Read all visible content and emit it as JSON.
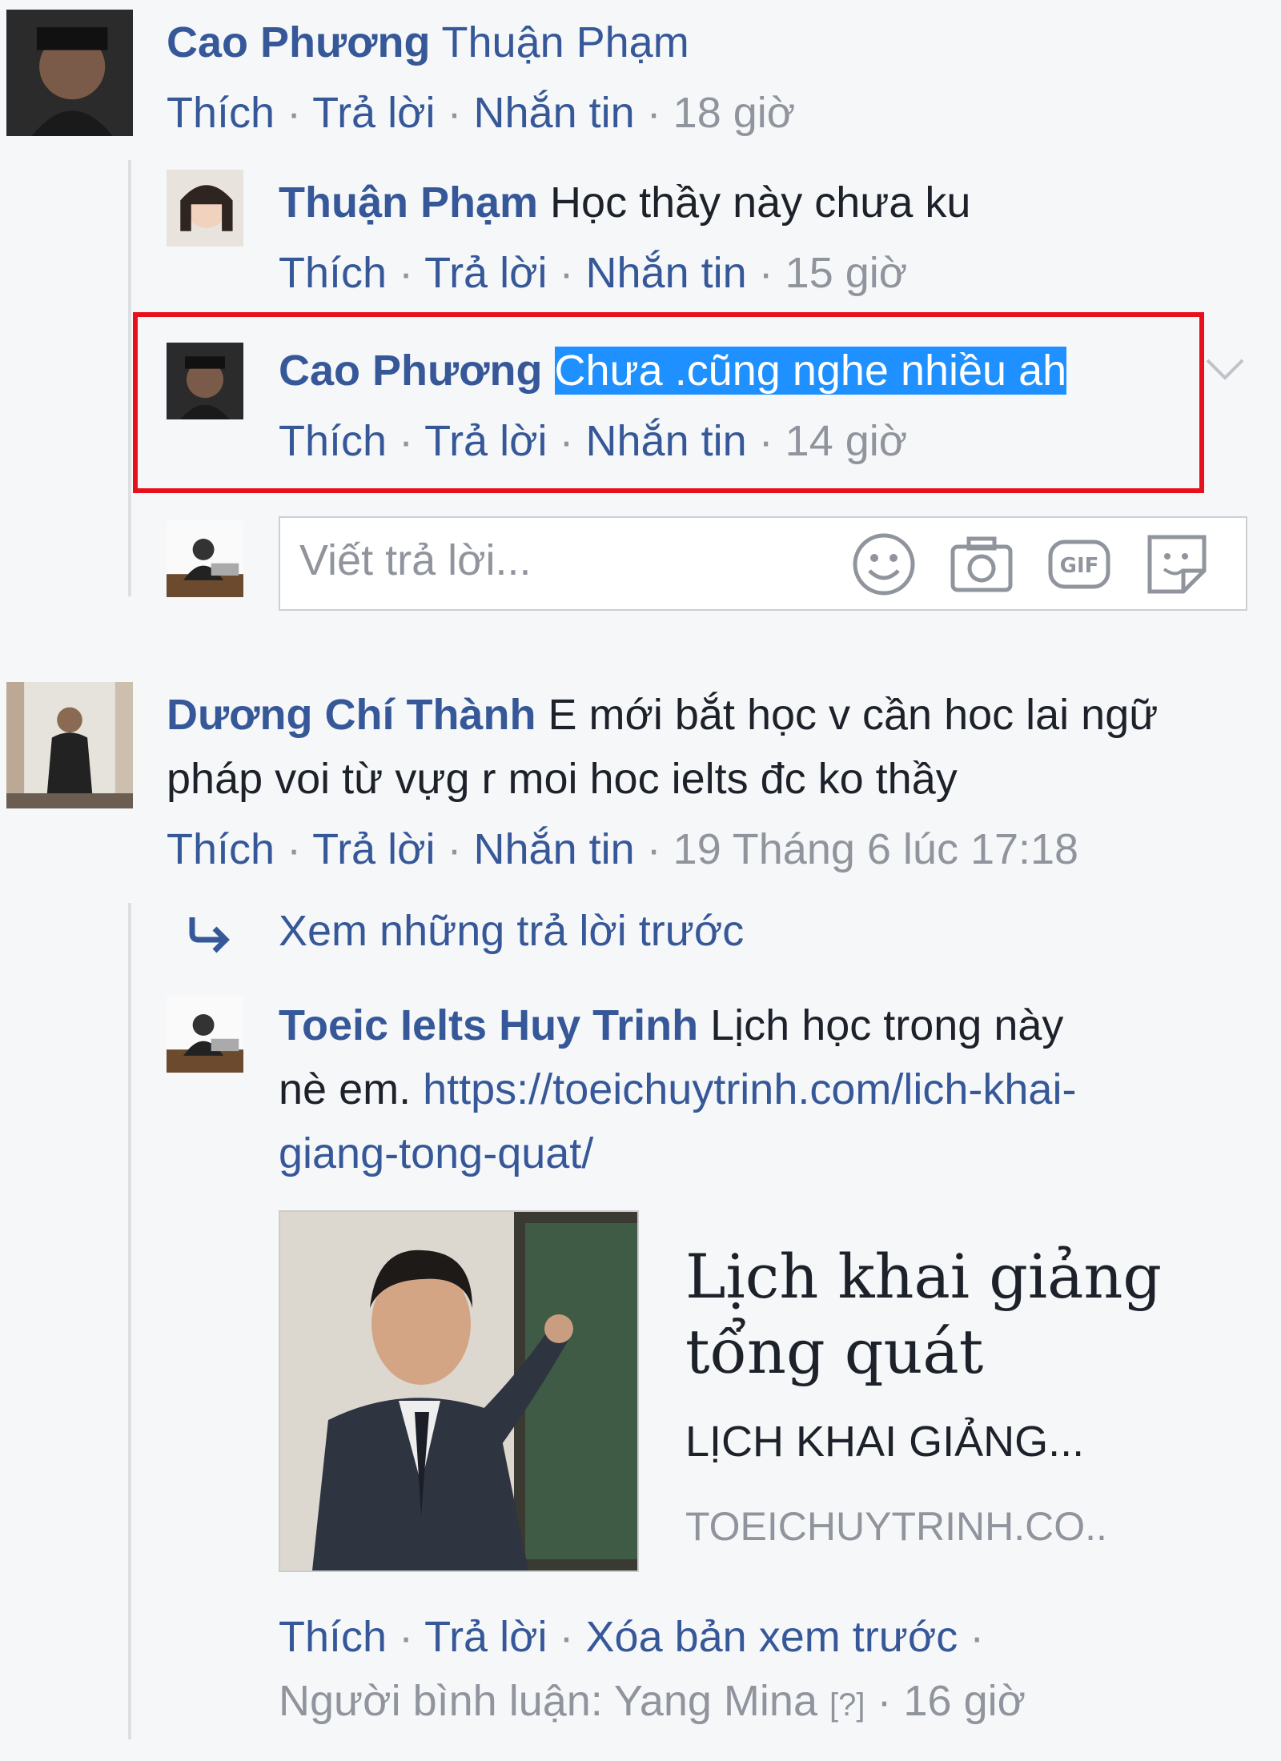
{
  "comments": [
    {
      "author": "Cao Phương",
      "text": "Thuận Phạm",
      "actions": {
        "like": "Thích",
        "reply": "Trả lời",
        "message": "Nhắn tin",
        "time": "18 giờ"
      },
      "replies": [
        {
          "author": "Thuận Phạm",
          "text": "Học thầy này chưa ku",
          "actions": {
            "like": "Thích",
            "reply": "Trả lời",
            "message": "Nhắn tin",
            "time": "15 giờ"
          }
        },
        {
          "author": "Cao Phương",
          "text": "Chưa .cũng nghe nhiều ah",
          "actions": {
            "like": "Thích",
            "reply": "Trả lời",
            "message": "Nhắn tin",
            "time": "14 giờ"
          }
        }
      ],
      "reply_input": {
        "placeholder": "Viết trả lời..."
      }
    },
    {
      "author": "Dương Chí Thành",
      "text_line1": "E mới bắt học v cần hoc lai ngữ",
      "text_line2": "pháp voi từ vựg r moi hoc ielts đc ko thầy",
      "actions": {
        "like": "Thích",
        "reply": "Trả lời",
        "message": "Nhắn tin",
        "time": "19 Tháng 6 lúc 17:18"
      },
      "view_previous": "Xem những trả lời trước",
      "replies": [
        {
          "author": "Toeic Ielts Huy Trinh",
          "text_line1": "Lịch học trong này",
          "text_line2": "nè em.",
          "link_part1": "https://toeichuytrinh.com/lich-khai-",
          "link_part2": "giang-tong-quat/",
          "preview": {
            "title_line1": "Lịch khai giảng",
            "title_line2": "tổng quát",
            "description": "LỊCH KHAI GIẢNG...",
            "domain": "TOEICHUYTRINH.CO.."
          },
          "actions": {
            "like": "Thích",
            "reply": "Trả lời",
            "remove_preview": "Xóa bản xem trước",
            "commenter": "Người bình luận: Yang Mina",
            "help": "[?]",
            "time": "16 giờ"
          }
        }
      ]
    }
  ],
  "colors": {
    "link": "#365899",
    "meta": "#90949c",
    "highlight_box": "#e8111b",
    "selection": "#1e90ff"
  }
}
